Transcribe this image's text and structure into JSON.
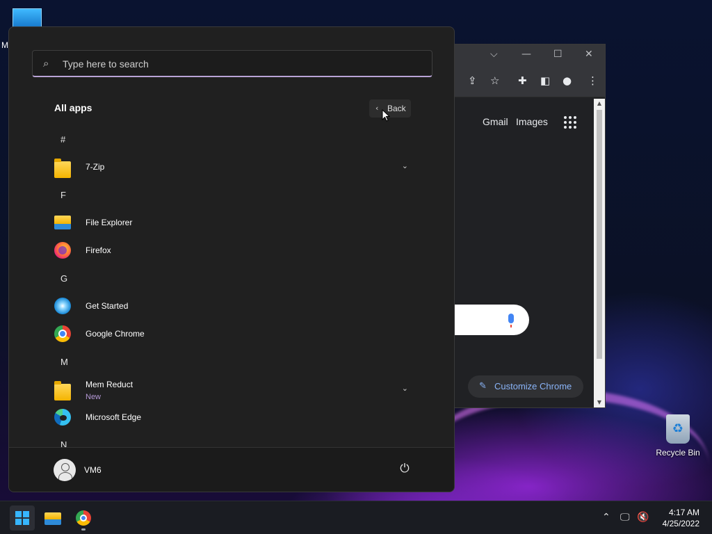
{
  "desktop": {
    "top_icon_letter": "M",
    "recycle_bin_label": "Recycle Bin"
  },
  "chrome_window": {
    "gmail_link": "Gmail",
    "images_link": "Images",
    "customize_label": "Customize Chrome"
  },
  "start_menu": {
    "search": {
      "placeholder": "Type here to search",
      "value": ""
    },
    "heading": "All apps",
    "back_label": "Back",
    "sections": [
      {
        "letter": "#",
        "apps": [
          {
            "name": "7-Zip",
            "icon": "folder-icon",
            "expandable": true
          }
        ]
      },
      {
        "letter": "F",
        "apps": [
          {
            "name": "File Explorer",
            "icon": "file-explorer-icon"
          },
          {
            "name": "Firefox",
            "icon": "firefox-icon"
          }
        ]
      },
      {
        "letter": "G",
        "apps": [
          {
            "name": "Get Started",
            "icon": "get-started-icon"
          },
          {
            "name": "Google Chrome",
            "icon": "chrome-icon"
          }
        ]
      },
      {
        "letter": "M",
        "apps": [
          {
            "name": "Mem Reduct",
            "sub": "New",
            "icon": "folder-icon",
            "expandable": true
          },
          {
            "name": "Microsoft Edge",
            "icon": "edge-icon"
          }
        ]
      },
      {
        "letter": "N",
        "apps": []
      }
    ],
    "user": {
      "name": "VM6"
    }
  },
  "taskbar": {
    "time": "4:17 AM",
    "date": "4/25/2022"
  },
  "colors": {
    "accent": "#b9a4d6",
    "start_bg": "#202020",
    "taskbar_bg": "#1a1c22",
    "windows_blue": "#37b6ff"
  }
}
